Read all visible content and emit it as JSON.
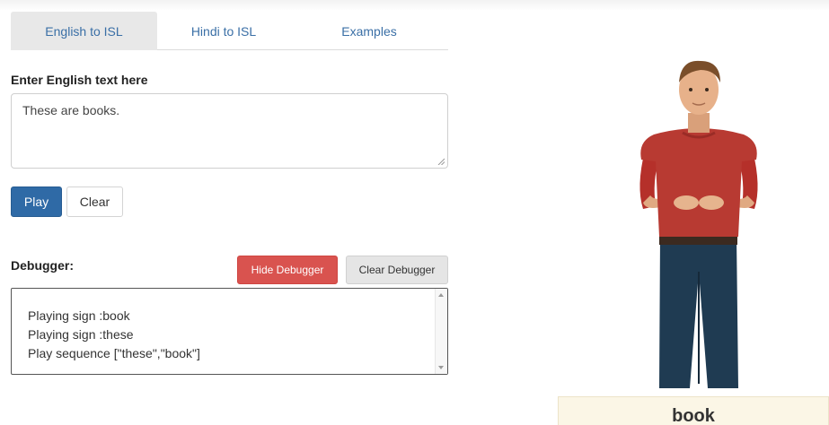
{
  "tabs": [
    {
      "label": "English to ISL",
      "active": true
    },
    {
      "label": "Hindi to ISL",
      "active": false
    },
    {
      "label": "Examples",
      "active": false
    }
  ],
  "input": {
    "label": "Enter English text here",
    "value": "These are books."
  },
  "buttons": {
    "play": "Play",
    "clear": "Clear",
    "hide_debugger": "Hide Debugger",
    "clear_debugger": "Clear Debugger"
  },
  "debugger": {
    "label": "Debugger:",
    "lines": [
      "Playing sign :book",
      "Playing sign :these",
      "Play sequence [\"these\",\"book\"]"
    ]
  },
  "avatar": {
    "current_sign": "book"
  },
  "colors": {
    "primary": "#2f6aa6",
    "danger": "#d9534f",
    "tab_active_bg": "#e8e8e8",
    "link": "#3a6fa6"
  }
}
